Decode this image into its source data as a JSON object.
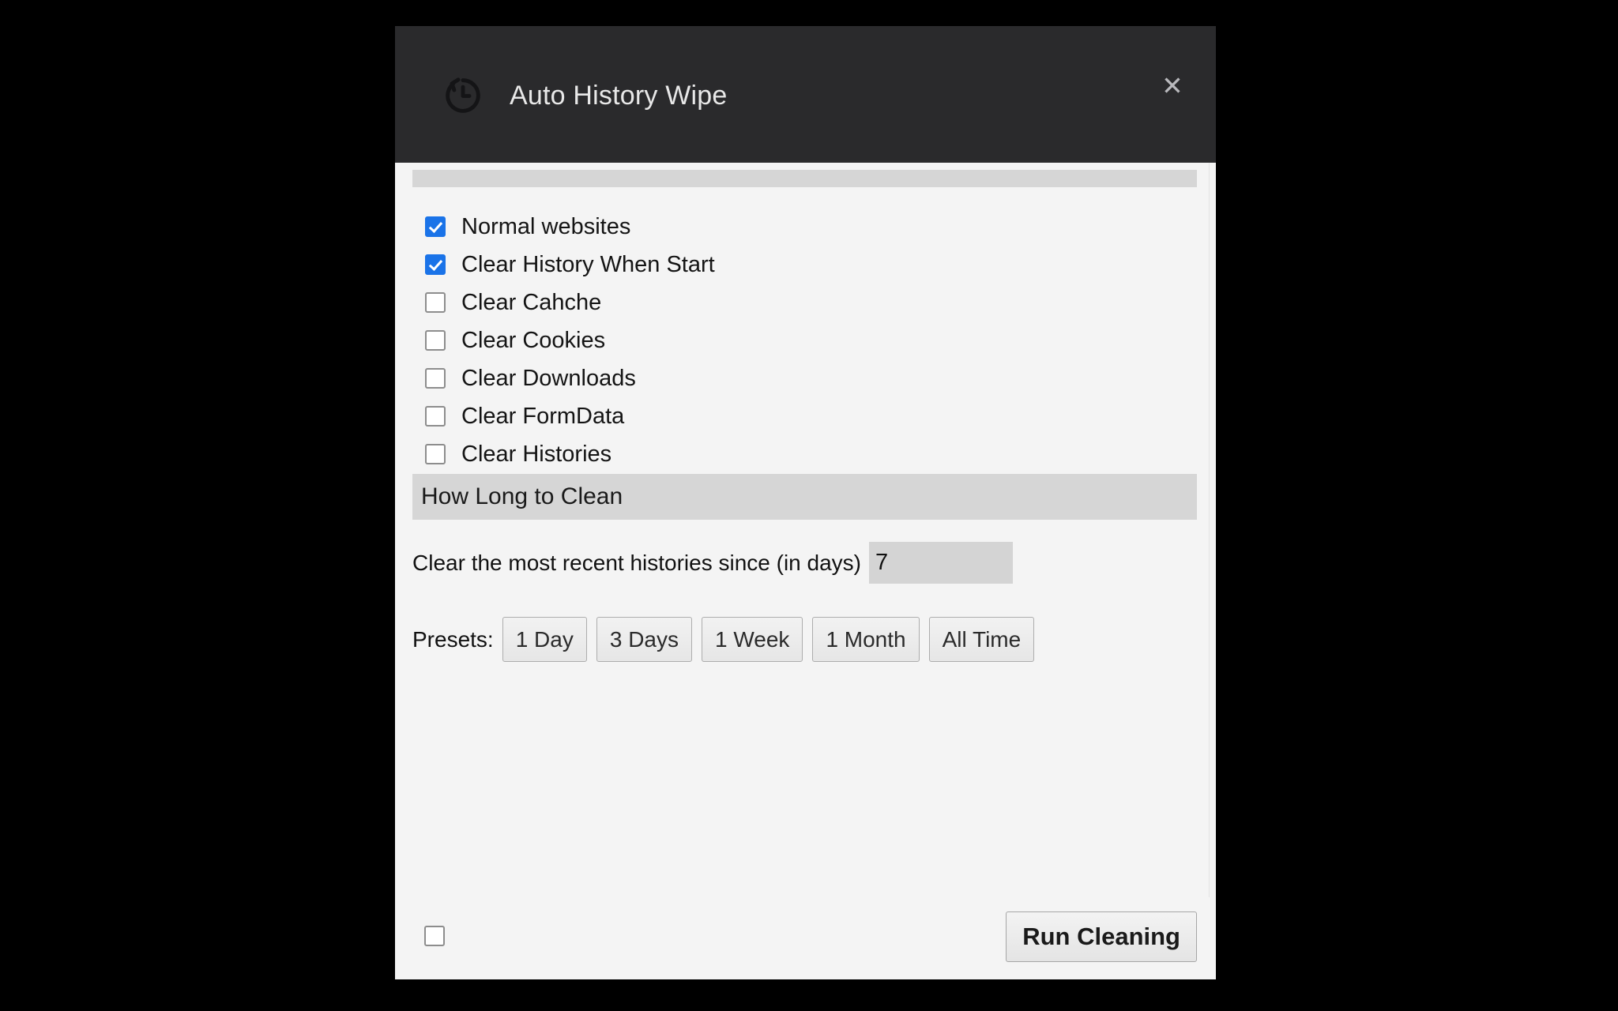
{
  "colors": {
    "header_background": "#2a2a2c",
    "panel_background": "#f4f4f4",
    "section_bar": "#d6d6d6",
    "checkbox_checked": "#1a73e8",
    "input_background": "#d4d4d4",
    "backdrop": "#000000"
  },
  "header": {
    "title": "Auto History Wipe",
    "icon": "history-icon",
    "close_label": "✕"
  },
  "options": {
    "items": [
      {
        "label": "Normal websites",
        "checked": true
      },
      {
        "label": "Clear History When Start",
        "checked": true
      },
      {
        "label": "Clear Cahche",
        "checked": false
      },
      {
        "label": "Clear Cookies",
        "checked": false
      },
      {
        "label": "Clear Downloads",
        "checked": false
      },
      {
        "label": "Clear FormData",
        "checked": false
      },
      {
        "label": "Clear Histories",
        "checked": false
      }
    ]
  },
  "duration": {
    "section_title": "How Long to Clean",
    "label": "Clear the most recent histories since (in days)",
    "days_value": "7",
    "days_placeholder": "7",
    "presets_label": "Presets:",
    "presets": [
      "1 Day",
      "3 Days",
      "1 Week",
      "1 Month",
      "All Time"
    ]
  },
  "footer": {
    "checkbox_checked": false,
    "run_label": "Run Cleaning"
  }
}
